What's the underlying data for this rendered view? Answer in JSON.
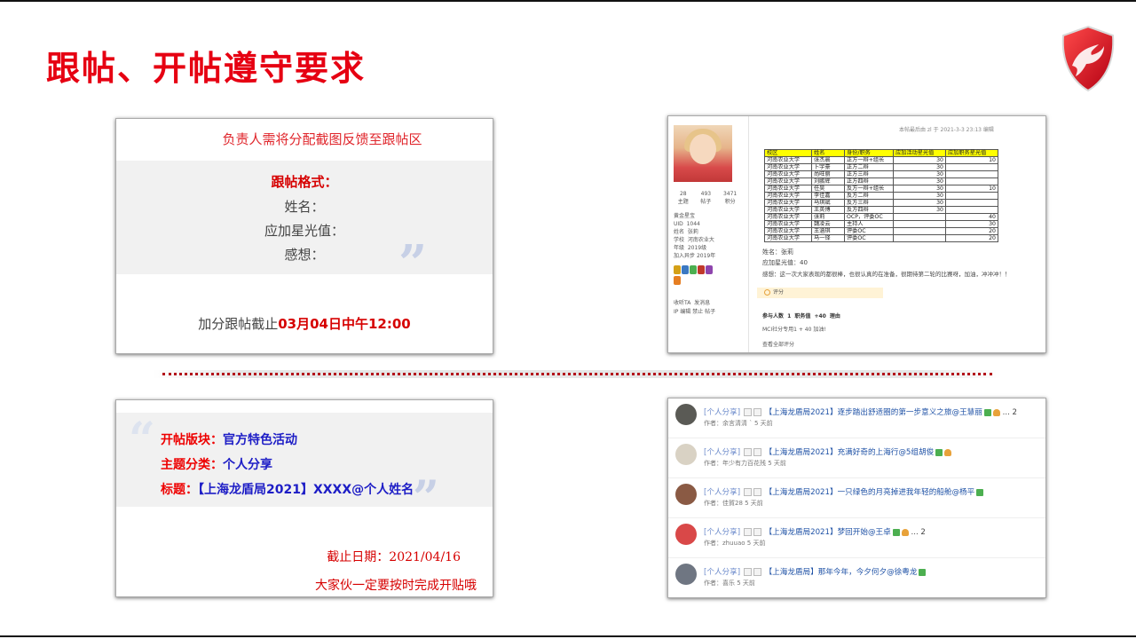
{
  "title": "跟帖、开帖遵守要求",
  "card1": {
    "head": "负责人需将分配截图反馈至跟帖区",
    "format_label": "跟帖格式：",
    "line_name": "姓名：",
    "line_star": "应加星光值：",
    "line_thoughts": "感想：",
    "deadline_prefix": "加分跟帖截止",
    "deadline_time": "03月04日中午12:00"
  },
  "card2": {
    "stats": [
      {
        "v": "28",
        "l": "主题"
      },
      {
        "v": "493",
        "l": "帖子"
      },
      {
        "v": "3471",
        "l": "积分"
      }
    ],
    "level": "黄金星宝",
    "info": [
      {
        "k": "UID",
        "v": "1044"
      },
      {
        "k": "姓名",
        "v": "张莉"
      },
      {
        "k": "学校",
        "v": "河南农业大"
      },
      {
        "k": "年级",
        "v": "2019级"
      },
      {
        "k": "加入异步",
        "v": "2019年"
      }
    ],
    "actions_1": "收听TA",
    "actions_2": "发消息",
    "actions_3": "IP 编辑 禁止 帖子",
    "meta": "本帖最后由 zl 于 2021-3-3 23:13 编辑",
    "table_header": [
      "校区",
      "姓名",
      "身份/职务",
      "应加活动星光值",
      "应加职务星光值"
    ],
    "table_rows": [
      [
        "河南农业大学",
        "张杰晨",
        "正方一辩+组长",
        "30",
        "10"
      ],
      [
        "河南农业大学",
        "卜宇豪",
        "正方二辩",
        "30",
        ""
      ],
      [
        "河南农业大学",
        "尚旺丽",
        "正方三辩",
        "30",
        ""
      ],
      [
        "河南农业大学",
        "刘鹏辉",
        "正方四辩",
        "30",
        ""
      ],
      [
        "河南农业大学",
        "任昊",
        "反方一辩+组长",
        "30",
        "10"
      ],
      [
        "河南农业大学",
        "李佳嘉",
        "反方二辩",
        "30",
        ""
      ],
      [
        "河南农业大学",
        "马琪斌",
        "反方三辩",
        "30",
        ""
      ],
      [
        "河南农业大学",
        "王英博",
        "反方四辩",
        "30",
        ""
      ],
      [
        "河南农业大学",
        "张莉",
        "OCP，评委OC",
        "",
        "40"
      ],
      [
        "河南农业大学",
        "魏凌云",
        "主持人",
        "",
        "30"
      ],
      [
        "河南农业大学",
        "王涵琪",
        "评委OC",
        "",
        "20"
      ],
      [
        "河南农业大学",
        "马一铎",
        "评委OC",
        "",
        "20"
      ]
    ],
    "post_name": "姓名：张莉",
    "post_star": "应加星光值：40",
    "post_thoughts": "感想：这一次大家表现的都很棒，也很认真的在准备，很期待第二轮的比赛呀，加油，冲冲冲！！",
    "rate_label": "评分",
    "rate_header": "参与人数 1    职务值 +40    理由",
    "rate_row": "MCI社分专用1  + 40    加油!",
    "rate_all": "查看全部评分"
  },
  "card3": {
    "l1_label": "开帖版块：",
    "l1_value": "官方特色活动",
    "l2_label": "主题分类：",
    "l2_value": "个人分享",
    "l3_label": "标题：",
    "l3_value": "【上海龙盾局2021】XXXX@个人姓名",
    "date": "截止日期：2021/04/16",
    "reminder": "大家伙一定要按时完成开贴哦"
  },
  "card4": {
    "threads": [
      {
        "category": "[个人分享]",
        "title": "【上海龙盾局2021】逐步踏出舒适圈的第一步意义之旅@王慧丽",
        "pages": "... 2",
        "author": "作者：余言清清 `   5 天前",
        "color": "#5a5a55",
        "thumb": true
      },
      {
        "category": "[个人分享]",
        "title": "【上海龙盾局2021】充满好奇的上海行@5组胡俊",
        "pages": "",
        "author": "作者：年少有力百花残   5 天前",
        "color": "#d9d2c4",
        "thumb": true
      },
      {
        "category": "[个人分享]",
        "title": "【上海龙盾局2021】一只绿色的月亮掉进我年轻的船舱@杨平",
        "pages": "",
        "author": "作者：佳賀28   5 天前",
        "color": "#8a5a44",
        "thumb": false
      },
      {
        "category": "[个人分享]",
        "title": "【上海龙盾局2021】梦回开始@王卓",
        "pages": "... 2",
        "author": "作者：zhuuao   5 天前",
        "color": "#d94848",
        "thumb": true
      },
      {
        "category": "[个人分享]",
        "title": "【上海龙盾局】那年今年，今夕何夕@徐粤龙",
        "pages": "",
        "author": "作者：喜乐   5 天前",
        "color": "#6f7682",
        "thumb": false
      }
    ]
  },
  "colors": {
    "accent_red": "#e60012",
    "link_blue": "#1f52a6",
    "label_blue": "#1d1dc6"
  }
}
